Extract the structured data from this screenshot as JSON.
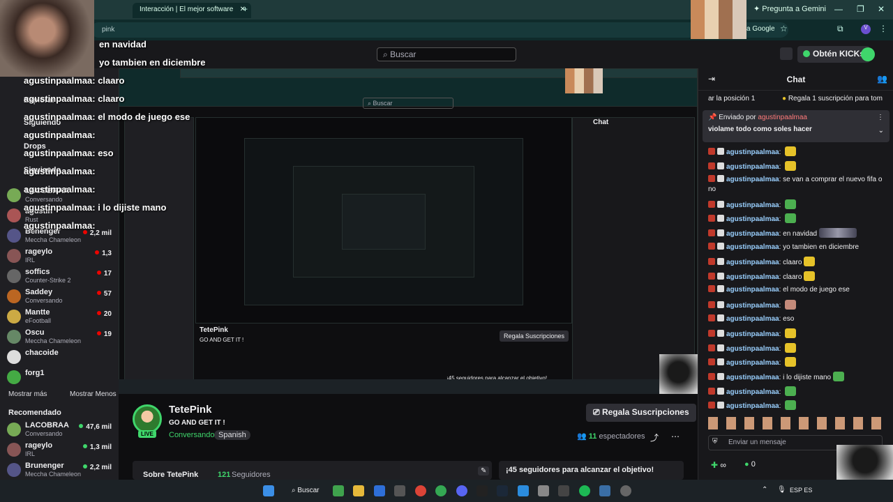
{
  "browser": {
    "tab_title": "Interacción | El mejor software",
    "new_tab": "+",
    "address_text": "pink",
    "gemini_label": "Pregunta a Gemini",
    "google_label": "a Google"
  },
  "twitch": {
    "search_placeholder": "Buscar",
    "kicks_label": "Obtén KICKs"
  },
  "sidebar": {
    "explorar": "Explorar",
    "siguiendo": "Siguiendo",
    "drops": "Drops",
    "siguiendo2": "Siguiendo",
    "followed": [
      {
        "name": "LACOBRAA",
        "game": "Conversando",
        "viewers": "",
        "color": "#7a5"
      },
      {
        "name": "agustin",
        "game": "Rust",
        "viewers": "",
        "color": "#a55"
      },
      {
        "name": "Benenger",
        "game": "Meccha Chameleon",
        "viewers": "2,2 mil",
        "color": "#558"
      },
      {
        "name": "rageylo",
        "game": "IRL",
        "viewers": "1,3",
        "color": "#855"
      },
      {
        "name": "soffics",
        "game": "Counter-Strike 2",
        "viewers": "17",
        "color": "#666"
      },
      {
        "name": "Saddey",
        "game": "Conversando",
        "viewers": "57",
        "color": "#b62"
      },
      {
        "name": "Mantte",
        "game": "eFootball",
        "viewers": "20",
        "color": "#ca4"
      },
      {
        "name": "Oscu",
        "game": "Meccha Chameleon",
        "viewers": "19",
        "color": "#686"
      },
      {
        "name": "chacoide",
        "game": "",
        "viewers": "",
        "color": "#ddd"
      },
      {
        "name": "forg1",
        "game": "",
        "viewers": "",
        "color": "#4a4"
      }
    ],
    "show_more": "Mostrar más",
    "show_less": "Mostrar Menos",
    "recommended_title": "Recomendado",
    "recommended": [
      {
        "name": "LACOBRAA",
        "game": "Conversando",
        "viewers": "47,6 mil",
        "color": "#7a5"
      },
      {
        "name": "rageylo",
        "game": "IRL",
        "viewers": "1,3 mil",
        "color": "#855"
      },
      {
        "name": "Brunenger",
        "game": "Meccha Chameleon",
        "viewers": "2,2 mil",
        "color": "#558"
      }
    ]
  },
  "overlay_messages": [
    {
      "text": "en navidad",
      "top": 0
    },
    {
      "text": "yo tambien en diciembre",
      "top": 0
    },
    {
      "text": "agustinpaalmaa: claaro",
      "top": 0
    },
    {
      "text": "agustinpaalmaa: claaro",
      "top": 0
    },
    {
      "text": "agustinpaalmaa: el modo de juego ese",
      "top": 0
    },
    {
      "text": "agustinpaalmaa:",
      "top": 0
    },
    {
      "text": "agustinpaalmaa: eso",
      "top": 0
    },
    {
      "text": "agustinpaalmaa:",
      "top": 0
    },
    {
      "text": "agustinpaalmaa:",
      "top": 0
    },
    {
      "text": "agustinpaalmaa: i lo dijiste mano",
      "top": 0
    },
    {
      "text": "agustinpaalmaa:",
      "top": 0
    }
  ],
  "stream": {
    "streamer": "TetePink",
    "title": "GO AND GET IT !",
    "category": "Conversando",
    "language": "Spanish",
    "live": "LIVE",
    "sub_button": "Regala Suscripciones",
    "viewers": "11",
    "viewers_label": "espectadores",
    "about": "Sobre TetePink",
    "followers": "121",
    "followers_label": "Seguidores",
    "goal": "¡45 seguidores para alcanzar el objetivo!"
  },
  "chat": {
    "title": "Chat",
    "ticker": "ar la posición 1",
    "ticker2": "Regala 1 suscripción para tom",
    "pinned_by": "Enviado por",
    "pinned_user": "agustinpaalmaa",
    "pinned_text": "violame todo como soles hacer",
    "messages": [
      {
        "user": "agustinpaalmaa",
        "text": "",
        "emote": "y"
      },
      {
        "user": "agustinpaalmaa",
        "text": "",
        "emote": "y"
      },
      {
        "user": "agustinpaalmaa",
        "text": "se van a comprar el nuevo fifa o no",
        "emote": ""
      },
      {
        "user": "agustinpaalmaa",
        "text": "",
        "emote": "g"
      },
      {
        "user": "agustinpaalmaa",
        "text": "",
        "emote": "g"
      },
      {
        "user": "agustinpaalmaa",
        "text": "en navidad",
        "emote": "img"
      },
      {
        "user": "agustinpaalmaa",
        "text": "yo tambien en diciembre",
        "emote": ""
      },
      {
        "user": "agustinpaalmaa",
        "text": "claaro",
        "emote": "y"
      },
      {
        "user": "agustinpaalmaa",
        "text": "claaro",
        "emote": "y"
      },
      {
        "user": "agustinpaalmaa",
        "text": "el modo de juego ese",
        "emote": ""
      },
      {
        "user": "agustinpaalmaa",
        "text": "",
        "emote": "p"
      },
      {
        "user": "agustinpaalmaa",
        "text": "eso",
        "emote": ""
      },
      {
        "user": "agustinpaalmaa",
        "text": "",
        "emote": "y"
      },
      {
        "user": "agustinpaalmaa",
        "text": "",
        "emote": "y"
      },
      {
        "user": "agustinpaalmaa",
        "text": "",
        "emote": "y"
      },
      {
        "user": "agustinpaalmaa",
        "text": "i lo dijiste mano",
        "emote": "g"
      },
      {
        "user": "agustinpaalmaa",
        "text": "",
        "emote": "g"
      },
      {
        "user": "agustinpaalmaa",
        "text": "",
        "emote": "g"
      }
    ],
    "input_placeholder": "Enviar un mensaje",
    "points": "∞",
    "kicks": "0"
  },
  "taskbar": {
    "search": "Buscar",
    "lang": "ESP ES"
  }
}
